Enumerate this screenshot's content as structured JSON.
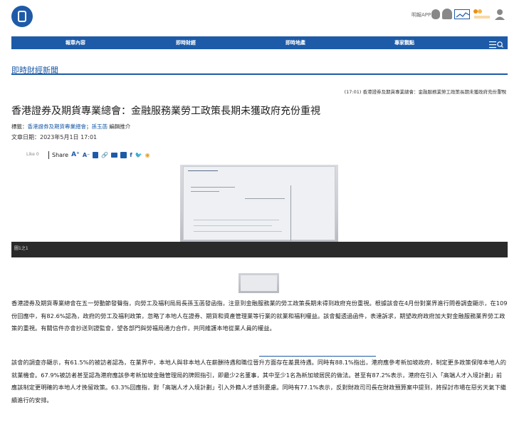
{
  "header": {
    "app_label": "明報APP"
  },
  "nav": {
    "items": [
      "報章內容",
      "即時財經",
      "即時地產",
      "專家觀點"
    ]
  },
  "section": {
    "title": "即時財經新聞"
  },
  "ticker": {
    "text": "(17:01) 香港證券及期貨專業總會：金融服務業勞工政策長期未獲政府充份重視"
  },
  "article": {
    "title": "香港證券及期貨專業總會：金融服務業勞工政策長期未獲政府充份重視",
    "tags_label": "標籤：",
    "tag1": "香港證券及期貨專業總會",
    "tag_sep": "；",
    "tag2": "孫玉菡",
    "tag_suffix": " 編輯推介",
    "date": "文章日期：2023年5月1日 17:01",
    "like": "Like 0",
    "share": "Share",
    "caption": "圖1之1",
    "para1": "香港證券及期貨專業總會在五一勞動節發聲指，向勞工及福利局局長孫玉菡發函指，注意到金融服務業的勞工政策長期未得到政府充份重視。根據該會在4月份對業界進行問卷調查顯示，在109份回應中，有82.6%認為，政府的勞工及福利政策，忽略了本地人在證券、期貨和資產管理業等行業的就業和福利權益。該會擬透過函件，表達訴求，期望政府政府加大對金融服務業界勞工政策的重視。有關信件亦會抄送到證監會，望各部門與勞福局通力合作，共同維護本地從業人員的權益。",
    "para2": "該會的調查亦顯示，有61.5%的被訪者認為，在業界中，本地人與非本地人在薪酬待遇和職位晉升方面存在差異待遇。同時有88.1%指出，港府應參考新加坡政府，制定更多政策保障本地人的就業機會。67.9%被訪者甚至認為港府應該參考新加坡金融管理局的牌照指引，即最少2名董事，其中至少1名為新加坡居民的做法。甚至有87.2%表示，港府在引入「高端人才入境計劃」前應該制定更明確的本地人才挽留政策。63.3%回應指，對「高端人才入境計劃」引入外籍人才感到憂慮。同時有77.1%表示，反對財政司司長在財政預算案中提到，將探討市場在惡劣天氣下繼續進行的安排。"
  },
  "colors": {
    "brand": "#1d5ba8",
    "caption_bg": "#2a2a2a"
  }
}
